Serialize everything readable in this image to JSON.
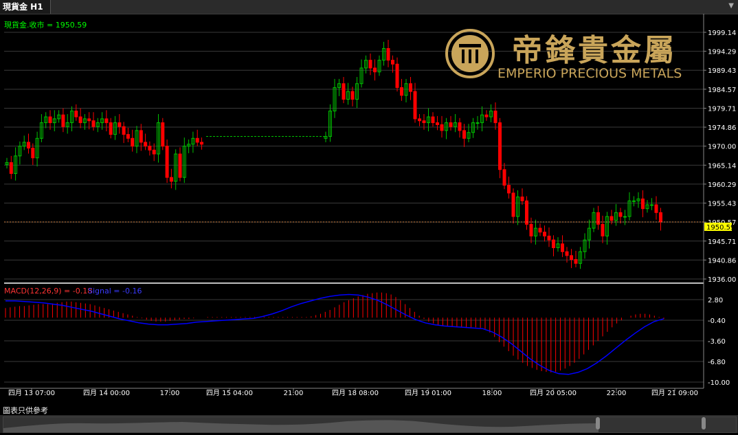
{
  "window": {
    "tab_title": "現貨金 H1",
    "menu_icon": "chevron-down-icon"
  },
  "watermark": {
    "chinese_name": "帝鋒貴金屬",
    "english_name": "EMPERIO PRECIOUS METALS",
    "logo_color": "#c9a55a"
  },
  "price_panel": {
    "label": "現貨金.收市 = 1950.59",
    "current_price": "1950.59",
    "y_ticks": [
      "1999.14",
      "1994.29",
      "1989.43",
      "1984.57",
      "1979.71",
      "1974.86",
      "1970.00",
      "1965.14",
      "1960.29",
      "1955.43",
      "1950.57",
      "1945.71",
      "1940.86",
      "1936.00"
    ],
    "ylim": [
      1936.0,
      2001.0
    ],
    "up_color": "#00c000",
    "down_color": "#ff0000",
    "flat_line_color": "#00c000",
    "current_line_color": "#d08040"
  },
  "macd_panel": {
    "label_macd": "MACD(12,26,9) = -0.18",
    "label_signal": "Signal = -0.16",
    "y_ticks": [
      "2.80",
      "-0.40",
      "-3.60",
      "-6.80",
      "-10.00"
    ],
    "ylim": [
      -10.6,
      4.6
    ],
    "hist_color": "#ff0000",
    "signal_color": "#0000ff"
  },
  "x_axis": {
    "labels": [
      "四月 13 07:00",
      "四月 14 00:00",
      "17:00",
      "四月 15 04:00",
      "21:00",
      "四月 18 08:00",
      "四月 19 01:00",
      "18:00",
      "四月 20 05:00",
      "22:00",
      "四月 21 09:00"
    ]
  },
  "footer": {
    "disclaimer": "圖表只供參考"
  },
  "chart_data": {
    "type": "candlestick",
    "title": "現貨金 H1",
    "timeframe": "H1",
    "last_close": 1950.59,
    "x_labels": [
      "四月 13 07:00",
      "四月 14 00:00",
      "17:00",
      "四月 15 04:00",
      "21:00",
      "四月 18 08:00",
      "四月 19 01:00",
      "18:00",
      "四月 20 05:00",
      "22:00",
      "四月 21 09:00"
    ],
    "segments": [
      {
        "name": "seg1",
        "points": [
          1965.8,
          1963,
          1967.5,
          1970,
          1971,
          1969.5,
          1967,
          1972,
          1976,
          1977.5,
          1976,
          1977,
          1978,
          1975,
          1976,
          1979,
          1977.5,
          1976,
          1977,
          1976.5,
          1975,
          1976,
          1977,
          1976,
          1973,
          1976,
          1975,
          1973,
          1972,
          1970,
          1974,
          1971,
          1970,
          1969,
          1968,
          1976,
          1970,
          1962,
          1961,
          1968,
          1962,
          1970,
          1970.5,
          1972,
          1971,
          1970.5
        ]
      },
      {
        "name": "flat",
        "points": [
          1972.5,
          1972.5
        ]
      },
      {
        "name": "seg2",
        "points": [
          1972.5,
          1979,
          1985,
          1986,
          1982,
          1984,
          1982,
          1986,
          1990,
          1992,
          1990,
          1989,
          1992,
          1995,
          1992,
          1991,
          1985,
          1983,
          1986,
          1984,
          1977,
          1976.5,
          1976,
          1977.5,
          1976,
          1975.5,
          1974,
          1976,
          1975,
          1976,
          1974,
          1972,
          1973.5,
          1976,
          1976,
          1978,
          1977.5,
          1979,
          1976,
          1964,
          1960,
          1958,
          1952,
          1957,
          1956,
          1950,
          1947,
          1949,
          1948,
          1947,
          1946,
          1944,
          1945,
          1943,
          1942,
          1941,
          1940,
          1943,
          1946,
          1949,
          1953,
          1950,
          1947,
          1952,
          1951,
          1953,
          1952,
          1952,
          1956,
          1956,
          1956.5,
          1954,
          1955,
          1955,
          1953,
          1950.59
        ]
      }
    ],
    "macd": {
      "histogram": [
        1.5,
        1.6,
        1.7,
        1.8,
        1.8,
        1.9,
        2.0,
        2.1,
        2.1,
        2.1,
        2.2,
        2.3,
        2.4,
        2.5,
        2.5,
        2.4,
        2.3,
        2.2,
        2.1,
        1.9,
        1.7,
        1.5,
        1.3,
        1.1,
        0.9,
        0.7,
        0.5,
        0.3,
        0.1,
        -0.1,
        -0.3,
        -0.5,
        -0.6,
        -0.6,
        -0.6,
        -0.5,
        -0.4,
        -0.3,
        -0.2,
        -0.2,
        -0.1,
        0.0,
        0.0,
        0.1,
        0.1,
        0.1,
        0.1,
        0.1,
        0.1,
        0.1,
        0.1,
        0.1,
        0.1,
        0.1,
        0.1,
        0.1,
        0.1,
        0.1,
        0.1,
        0.1,
        0.1,
        0.1,
        0.1,
        0.1,
        0.1,
        0.2,
        0.4,
        0.6,
        0.9,
        1.2,
        1.6,
        2.0,
        2.4,
        2.7,
        3.0,
        3.3,
        3.5,
        3.7,
        3.8,
        3.9,
        3.9,
        3.8,
        3.6,
        3.2,
        2.7,
        2.1,
        1.5,
        0.9,
        0.3,
        -0.2,
        -0.6,
        -0.9,
        -1.1,
        -1.2,
        -1.3,
        -1.4,
        -1.4,
        -1.5,
        -1.5,
        -1.5,
        -1.5,
        -1.6,
        -1.8,
        -2.3,
        -3.0,
        -3.8,
        -4.5,
        -5.2,
        -5.9,
        -6.5,
        -7.0,
        -7.5,
        -7.8,
        -8.1,
        -8.3,
        -8.4,
        -8.5,
        -8.4,
        -8.2,
        -7.9,
        -7.5,
        -7.0,
        -6.4,
        -5.7,
        -5.0,
        -4.3,
        -3.6,
        -2.9,
        -2.2,
        -1.5,
        -0.9,
        -0.4,
        0.0,
        0.3,
        0.5,
        0.6,
        0.6,
        0.5,
        0.3,
        0.1,
        -0.18
      ],
      "signal": [
        2.6,
        2.6,
        2.5,
        2.4,
        2.3,
        2.1,
        1.9,
        1.6,
        1.3,
        1.0,
        0.6,
        0.2,
        -0.2,
        -0.5,
        -0.8,
        -1.0,
        -1.1,
        -1.1,
        -1.0,
        -0.9,
        -0.7,
        -0.6,
        -0.5,
        -0.4,
        -0.3,
        -0.2,
        -0.1,
        0.2,
        0.6,
        1.1,
        1.7,
        2.2,
        2.6,
        3.0,
        3.3,
        3.5,
        3.6,
        3.5,
        3.2,
        2.7,
        2.0,
        1.2,
        0.4,
        -0.3,
        -0.8,
        -1.1,
        -1.3,
        -1.4,
        -1.5,
        -1.6,
        -1.7,
        -2.2,
        -3.0,
        -4.0,
        -5.2,
        -6.4,
        -7.4,
        -8.2,
        -8.7,
        -8.8,
        -8.5,
        -7.9,
        -7.0,
        -5.9,
        -4.7,
        -3.5,
        -2.4,
        -1.4,
        -0.6,
        -0.16
      ]
    }
  }
}
